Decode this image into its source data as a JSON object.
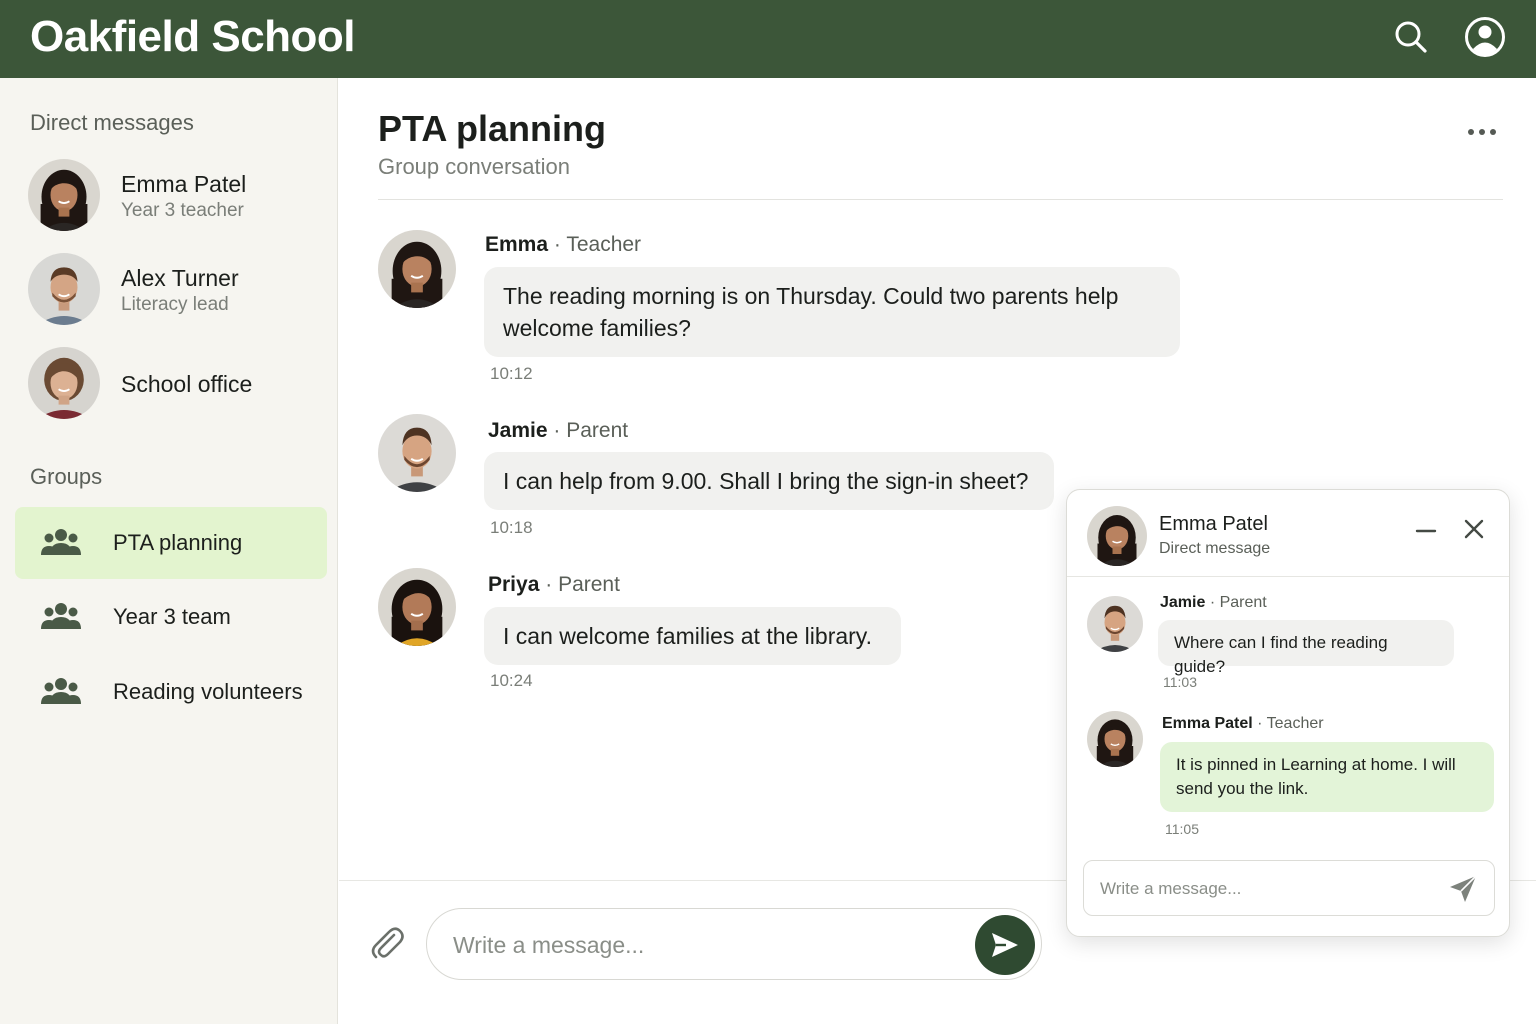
{
  "app": {
    "name": "Oakfield School"
  },
  "colors": {
    "header_bg": "#3c5639",
    "sidebar_bg": "#f6f5f0",
    "active_group_bg": "#e3f4cf",
    "send_button": "#2f4a31",
    "incoming_bubble": "#f1f1ef",
    "own_bubble": "#e3f4d8"
  },
  "header_icons": [
    "search-icon",
    "account-icon"
  ],
  "sidebar": {
    "direct_title": "Direct messages",
    "direct": [
      {
        "name": "Emma Patel",
        "sub": "Year 3 teacher",
        "avatar": "emma"
      },
      {
        "name": "Alex Turner",
        "sub": "Literacy lead",
        "avatar": "alex"
      },
      {
        "name": "School office",
        "sub": "",
        "avatar": "office"
      }
    ],
    "groups_title": "Groups",
    "groups": [
      {
        "label": "PTA planning",
        "active": true,
        "icon": "group-icon"
      },
      {
        "label": "Year 3 team",
        "active": false,
        "icon": "group-icon"
      },
      {
        "label": "Reading volunteers",
        "active": false,
        "icon": "group-icon"
      }
    ]
  },
  "conversation": {
    "title": "PTA planning",
    "subtitle": "Group conversation",
    "messages": [
      {
        "author": "Emma",
        "separator": "·",
        "role": "Teacher",
        "text": "The reading morning is on Thursday. Could two parents help welcome families?",
        "time": "10:12",
        "avatar": "emma"
      },
      {
        "author": "Jamie",
        "separator": "·",
        "role": "Parent",
        "text": "I can help from 9.00. Shall I bring the sign-in sheet?",
        "time": "10:18",
        "avatar": "jamie"
      },
      {
        "author": "Priya",
        "separator": "·",
        "role": "Parent",
        "text": "I can welcome families at the library.",
        "time": "10:24",
        "avatar": "priya"
      }
    ],
    "composer_placeholder": "Write a message..."
  },
  "dm_panel": {
    "name": "Emma Patel",
    "subtitle": "Direct message",
    "messages": [
      {
        "author": "Jamie",
        "separator": "·",
        "role": "Parent",
        "text": "Where can I find the reading guide?",
        "time": "11:03",
        "avatar": "jamie"
      },
      {
        "author": "Emma Patel",
        "separator": "·",
        "role": "Teacher",
        "text": "It is pinned in Learning at home. I will send you the link.",
        "time": "11:05",
        "avatar": "emma"
      }
    ],
    "composer_placeholder": "Write a message..."
  }
}
